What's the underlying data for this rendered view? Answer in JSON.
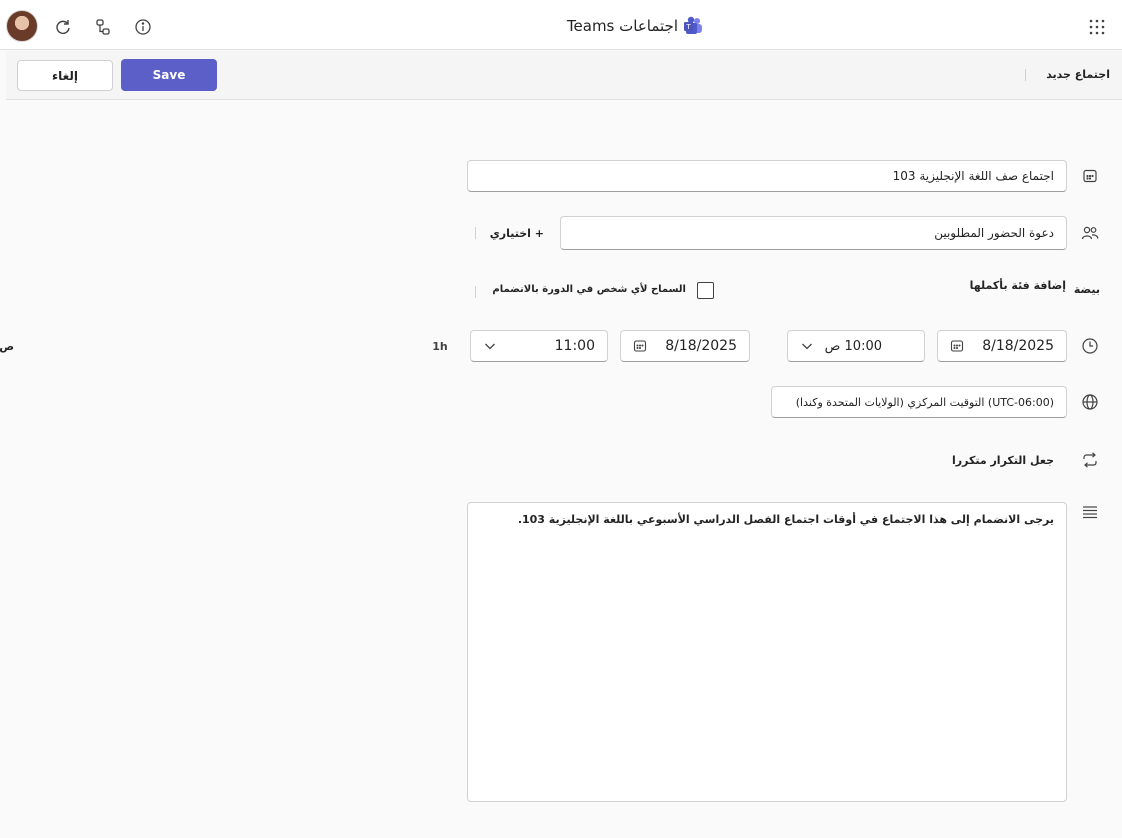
{
  "titlebar": {
    "app_title": "اجتماعات Teams",
    "logo_icon": "teams-logo-icon",
    "info_icon": "info-icon",
    "reload_icon": "reload-icon",
    "connect_icon": "connect-icon",
    "apps_icon": "apps-grid-icon"
  },
  "toolbar": {
    "page_label": "اجتماع جديد",
    "save_label": "Save",
    "cancel_label": "إلغاء",
    "save_color": "#5b5fc7"
  },
  "form": {
    "title_value": "اجتماع صف اللغة الإنجليزية 103",
    "attendees_placeholder": "دعوة الحضور المطلوبين",
    "optional_label": "+ اختياري",
    "channel_label": "إضافة فئة بأكملها",
    "channel_side": "بيضة",
    "allow_join_label": "السماح لأي شخص في الدورة بالانضمام",
    "start_date": "8/18/2025",
    "start_time": "10:00 ص",
    "end_date": "8/18/2025",
    "end_time": "11:00",
    "end_time_suffix": "ص",
    "duration": "1h",
    "timezone": "(UTC-06:00) التوقيت المركزي (الولايات المتحدة وكندا)",
    "recurrence_label": "جعل التكرار متكررا",
    "description": "يرجى الانضمام إلى هذا الاجتماع في أوقات اجتماع الفصل الدراسي الأسبوعي باللغة الإنجليزية 103."
  }
}
